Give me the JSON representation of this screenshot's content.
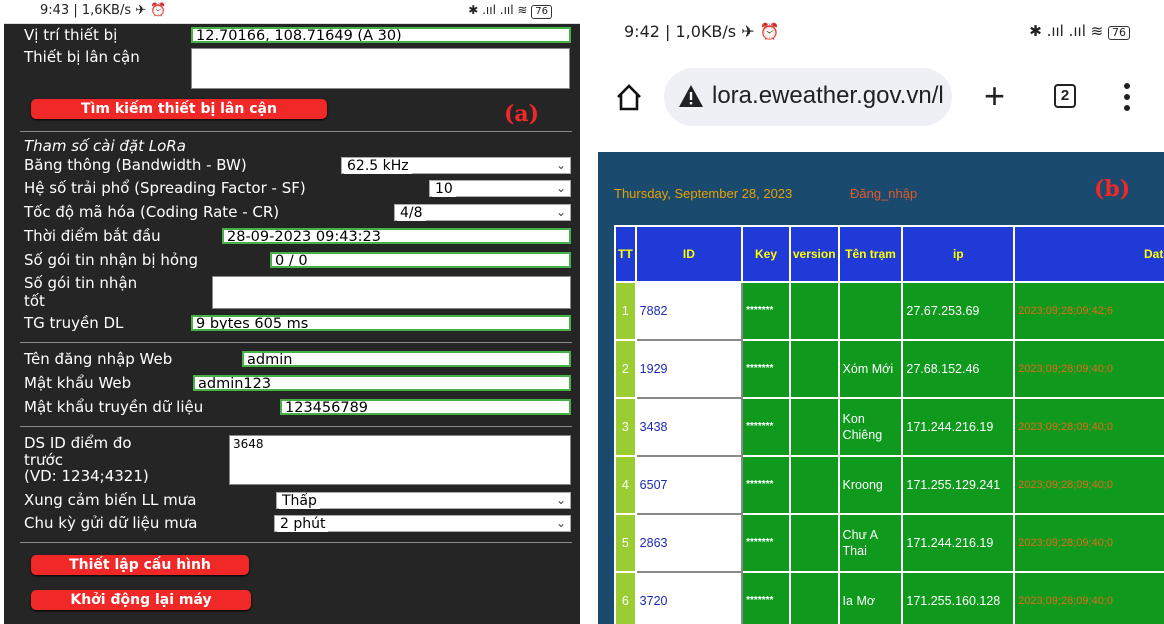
{
  "panel_a": {
    "tag": "(a)",
    "status": {
      "time": "9:43 | 1,6KB/s",
      "icons": "✈︎ ⏰",
      "right": "✱ .ııl .ııl ≋",
      "battery": "76"
    },
    "vi_tri_label": "Vị trí thiết bị",
    "vi_tri_value": "12.70166, 108.71649 (A 30)",
    "lan_can_label": "Thiết bị lân cận",
    "lan_can_value": "",
    "btn_tim_kiem": "Tìm kiếm thiết bị lân cận",
    "lora_heading": "Tham số cài đặt LoRa",
    "bw_label": "Băng thông (Bandwidth - BW)",
    "bw_value": "62.5 kHz",
    "sf_label": "Hệ số trải phổ (Spreading Factor - SF)",
    "sf_value": "10",
    "cr_label": "Tốc độ mã hóa (Coding Rate - CR)",
    "cr_value": "4/8",
    "start_label": "Thời điểm bắt đầu",
    "start_value": "28-09-2023 09:43:23",
    "bad_label": "Số gói tin nhận bị hỏng",
    "bad_value": "0 / 0",
    "good_label_1": "Số gói tin nhận",
    "good_label_2": "tốt",
    "good_value": "",
    "tg_label": "TG truyền DL",
    "tg_value": "9 bytes 605 ms",
    "web_user_label": "Tên đăng nhập Web",
    "web_user_value": "admin",
    "web_pass_label": "Mật khẩu Web",
    "web_pass_value": "admin123",
    "data_pass_label": "Mật khẩu truyền dữ liệu",
    "data_pass_value": "123456789",
    "ds_label_1": "DS ID điểm đo",
    "ds_label_2": "trước",
    "ds_label_3": "(VD: 1234;4321)",
    "ds_value": "3648",
    "xung_label": "Xung cảm biến LL mưa",
    "xung_value": "Thấp",
    "chu_ky_label": "Chu kỳ gửi dữ liệu mưa",
    "chu_ky_value": "2 phút",
    "btn_thiet_lap": "Thiết lập cấu hình",
    "btn_khoi_dong": "Khởi động lại máy"
  },
  "panel_b": {
    "tag": "(b)",
    "status": {
      "time": "9:42 | 1,0KB/s",
      "icons": "✈︎ ⏰",
      "right": "✱ .ııl .ııl ≋",
      "battery": "76"
    },
    "url": "lora.eweather.gov.vn/l",
    "tab_count": "2",
    "date": "Thursday, September 28, 2023",
    "login": "Đăng_nhập",
    "headers": [
      "TT",
      "ID",
      "Key",
      "version",
      "Tên trạm",
      "ip",
      "Data"
    ],
    "rows": [
      {
        "tt": "1",
        "id": "7882",
        "key": "*******",
        "version": "",
        "name": "",
        "ip": "27.67.253.69",
        "data": "2023;09;28;09;42;6"
      },
      {
        "tt": "2",
        "id": "1929",
        "key": "*******",
        "version": "",
        "name": "Xóm Mới",
        "ip": "27.68.152.46",
        "data": "2023;09;28;09;40;0"
      },
      {
        "tt": "3",
        "id": "3438",
        "key": "*******",
        "version": "",
        "name": "Kon Chiêng",
        "ip": "171.244.216.19",
        "data": "2023;09;28;09;40;0"
      },
      {
        "tt": "4",
        "id": "6507",
        "key": "*******",
        "version": "",
        "name": "Kroong",
        "ip": "171.255.129.241",
        "data": "2023;09;28;09;40;0"
      },
      {
        "tt": "5",
        "id": "2863",
        "key": "*******",
        "version": "",
        "name": "Chư A Thai",
        "ip": "171.244.216.19",
        "data": "2023;09;28;09;40;0"
      },
      {
        "tt": "6",
        "id": "3720",
        "key": "*******",
        "version": "",
        "name": "Ia Mơ",
        "ip": "171.255.160.128",
        "data": "2023;09;28;09;40;0"
      }
    ]
  },
  "colors": {
    "accent_red": "#f02828",
    "table_green": "#0f9a1e",
    "header_blue": "#1f3ad6",
    "date_orange": "#d97a00"
  }
}
